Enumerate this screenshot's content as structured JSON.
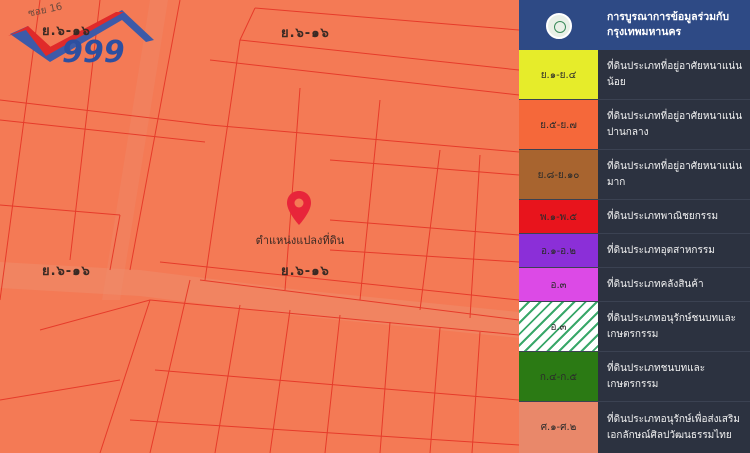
{
  "map": {
    "zone_labels": [
      "ย.๖-๑๖",
      "ย.๖-๑๖",
      "ย.๖-๑๖",
      "ย.๖-๑๖"
    ],
    "road_label": "ซอย 16",
    "pin_caption": "ตำแหน่งแปลงที่ดิน",
    "pin_color": "#e8253a",
    "zone_color": "#f47a55",
    "line_color": "#e63b2a"
  },
  "legend": {
    "header_title": "การบูรณาการข้อมูลร่วมกับกรุงเทพมหานคร",
    "items": [
      {
        "code": "ย.๑-ย.๔",
        "label": "ที่ดินประเภทที่อยู่อาศัยหนาแน่นน้อย",
        "color": "#e6ec2a"
      },
      {
        "code": "ย.๕-ย.๗",
        "label": "ที่ดินประเภทที่อยู่อาศัยหนาแน่นปานกลาง",
        "color": "#f5683a"
      },
      {
        "code": "ย.๘-ย.๑๐",
        "label": "ที่ดินประเภทที่อยู่อาศัยหนาแน่นมาก",
        "color": "#a8642f"
      },
      {
        "code": "พ.๑-พ.๕",
        "label": "ที่ดินประเภทพาณิชยกรรม",
        "color": "#e8141c"
      },
      {
        "code": "อ.๑-อ.๒",
        "label": "ที่ดินประเภทอุตสาหกรรม",
        "color": "#8b2fd8"
      },
      {
        "code": "อ.๓",
        "label": "ที่ดินประเภทคลังสินค้า",
        "color": "#dc4ae6"
      },
      {
        "code": "อ.๓",
        "label": "ที่ดินประเภทอนุรักษ์ชนบทและเกษตรกรรม",
        "color": "#ffffff"
      },
      {
        "code": "ก.๔-ก.๕",
        "label": "ที่ดินประเภทชนบทและเกษตรกรรม",
        "color": "#2b7a14"
      },
      {
        "code": "ศ.๑-ศ.๒",
        "label": "ที่ดินประเภทอนุรักษ์เพื่อส่งเสริมเอกลักษณ์ศิลปวัฒนธรรมไทย",
        "color": "#e9886a"
      }
    ]
  }
}
